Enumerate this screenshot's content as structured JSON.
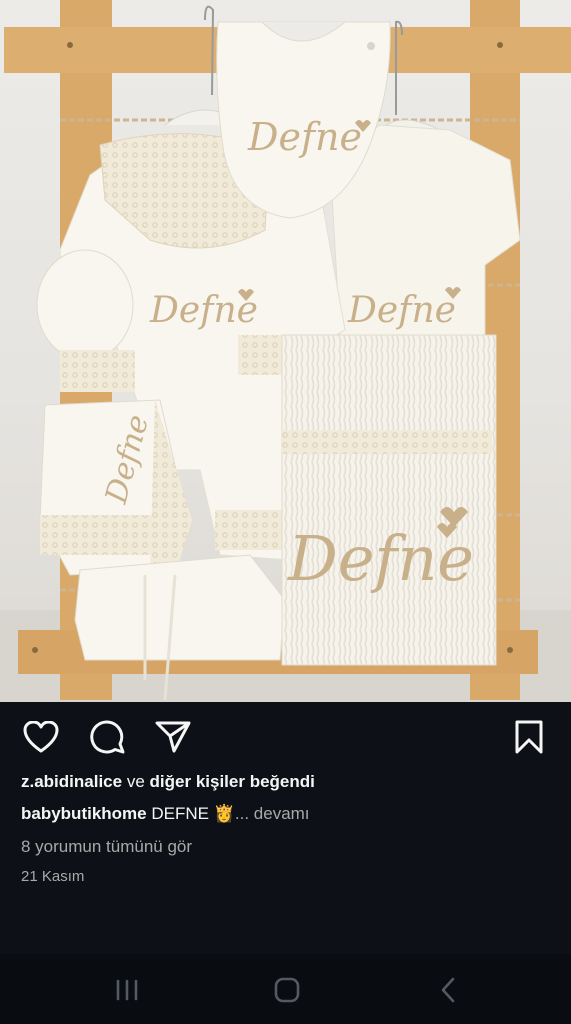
{
  "photo": {
    "alt_icon": "photo-baby-clothes-set",
    "embroidery": [
      "Defne",
      "Defne",
      "Defne",
      "Defne",
      "Defne"
    ]
  },
  "actions": {
    "like_icon": "heart-icon",
    "comment_icon": "comment-icon",
    "share_icon": "send-icon",
    "save_icon": "bookmark-icon"
  },
  "post": {
    "likes_user": "z.abidinalice",
    "likes_mid": "ve",
    "likes_rest": "diğer kişiler beğendi",
    "author": "babybutikhome",
    "caption_text": "DEFNE",
    "caption_emoji": "👸",
    "more_label": "... devamı",
    "comments_link": "8 yorumun tümünü gör",
    "date": "21 Kasım"
  },
  "system_nav": {
    "recents_icon": "recent-apps-icon",
    "home_icon": "home-icon",
    "back_icon": "back-icon"
  },
  "colors": {
    "background": "#0d1117",
    "text_primary": "#f5f5f5",
    "text_secondary": "#a8a8a8",
    "frame_wood": "#d9a96a",
    "fabric": "#f7f4ec",
    "embroidery": "#c8b08a"
  }
}
